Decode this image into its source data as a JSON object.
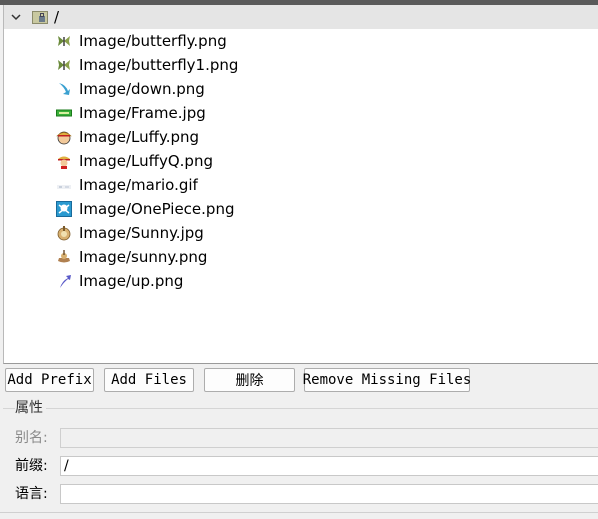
{
  "tree": {
    "root_label": "/",
    "items": [
      {
        "label": "Image/butterfly.png",
        "icon": "butterfly-icon"
      },
      {
        "label": "Image/butterfly1.png",
        "icon": "butterfly-icon"
      },
      {
        "label": "Image/down.png",
        "icon": "arrow-down-icon"
      },
      {
        "label": "Image/Frame.jpg",
        "icon": "frame-icon"
      },
      {
        "label": "Image/Luffy.png",
        "icon": "luffy-icon"
      },
      {
        "label": "Image/LuffyQ.png",
        "icon": "luffyq-icon"
      },
      {
        "label": "Image/mario.gif",
        "icon": "mario-icon"
      },
      {
        "label": "Image/OnePiece.png",
        "icon": "onepiece-icon"
      },
      {
        "label": "Image/Sunny.jpg",
        "icon": "sunny-icon"
      },
      {
        "label": "Image/sunny.png",
        "icon": "sunny-icon"
      },
      {
        "label": "Image/up.png",
        "icon": "arrow-up-icon"
      }
    ]
  },
  "buttons": {
    "add_prefix": "Add Prefix",
    "add_files": "Add Files",
    "delete": "删除",
    "remove_missing": "Remove Missing Files"
  },
  "properties": {
    "group_title": "属性",
    "alias_label": "别名:",
    "alias_value": "",
    "prefix_label": "前缀:",
    "prefix_value": "/",
    "language_label": "语言:",
    "language_value": ""
  },
  "colors": {
    "root_row_bg": "#e5e5e5",
    "tree_bg": "#ffffff",
    "window_bg": "#f0f0f0"
  }
}
